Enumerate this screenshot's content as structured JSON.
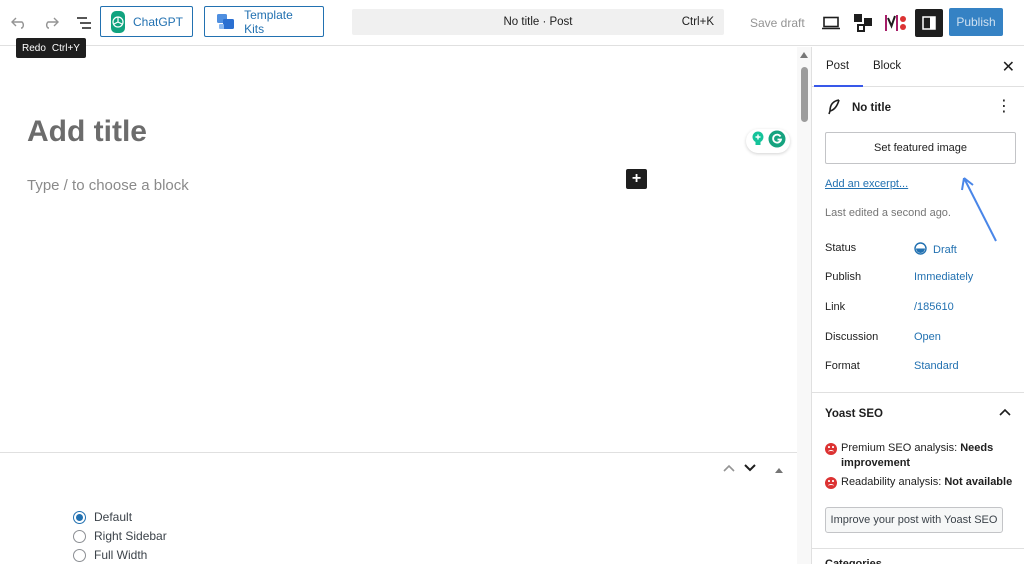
{
  "toolbar": {
    "chatgpt_label": "ChatGPT",
    "template_kits_label": "Template Kits",
    "command_title": "No title · Post",
    "command_shortcut": "Ctrl+K",
    "save_draft_label": "Save draft",
    "publish_label": "Publish",
    "tooltip": {
      "label": "Redo",
      "shortcut": "Ctrl+Y"
    },
    "icons": [
      "undo-icon",
      "redo-icon",
      "document-overview-icon",
      "chatgpt-logo-icon",
      "template-kits-icon",
      "preview-icon",
      "blocks-extension-icon",
      "yoast-icon",
      "settings-sidebar-icon"
    ]
  },
  "editor": {
    "title_placeholder": "Add title",
    "block_placeholder": "Type / to choose a block",
    "inserter_label": "+"
  },
  "meta_panel": {
    "layout_options": [
      {
        "label": "Default",
        "checked": true
      },
      {
        "label": "Right Sidebar",
        "checked": false
      },
      {
        "label": "Full Width",
        "checked": false
      }
    ]
  },
  "sidebar": {
    "tabs": [
      "Post",
      "Block"
    ],
    "active_tab": "Post",
    "close_label": "✕",
    "document_title": "No title",
    "featured_image_button": "Set featured image",
    "excerpt_link": "Add an excerpt...",
    "last_edited": "Last edited a second ago.",
    "properties": [
      {
        "label": "Status",
        "value": "Draft"
      },
      {
        "label": "Publish",
        "value": "Immediately"
      },
      {
        "label": "Link",
        "value": "/185610"
      },
      {
        "label": "Discussion",
        "value": "Open"
      },
      {
        "label": "Format",
        "value": "Standard"
      }
    ],
    "yoast": {
      "heading": "Yoast SEO",
      "premium_prefix": "Premium SEO analysis: ",
      "premium_status": "Needs improvement",
      "readability_prefix": "Readability analysis: ",
      "readability_status": "Not available",
      "improve_button": "Improve your post with Yoast SEO"
    },
    "next_section_heading": "Categories"
  },
  "colors": {
    "accent": "#2271b1",
    "publish_bg": "#3582c4",
    "error_red": "#dc3232",
    "active_tab": "#3858e9"
  }
}
